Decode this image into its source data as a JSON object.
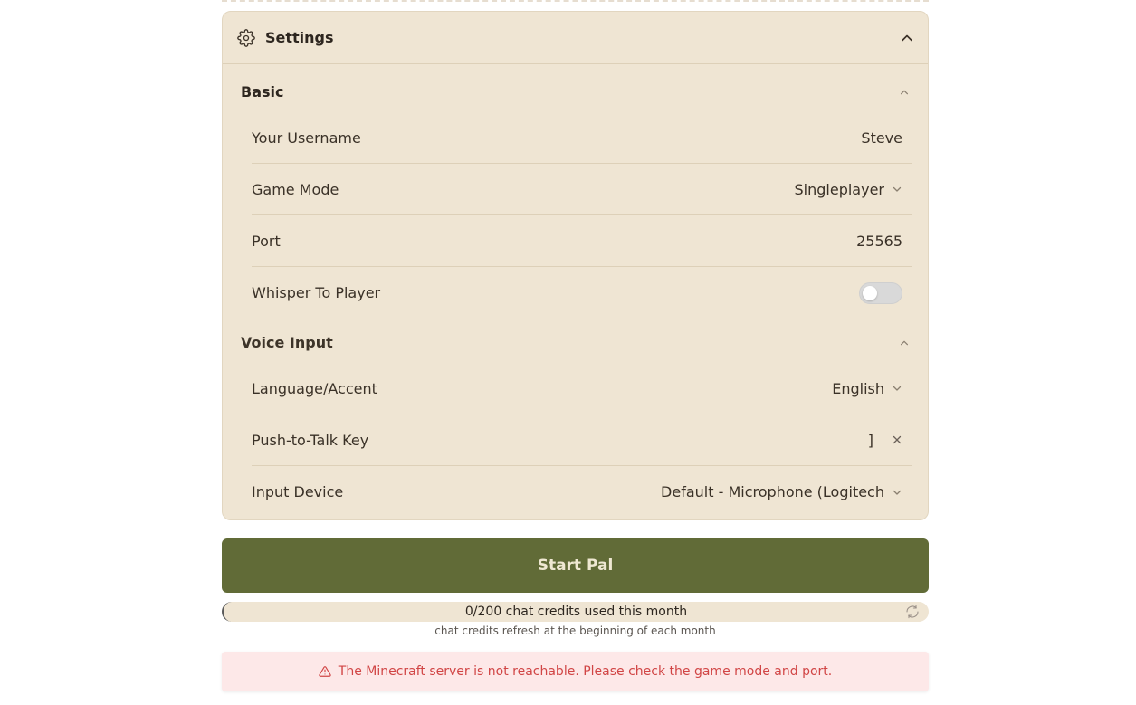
{
  "settings": {
    "title": "Settings",
    "basic": {
      "title": "Basic",
      "username_label": "Your Username",
      "username_value": "Steve",
      "game_mode_label": "Game Mode",
      "game_mode_value": "Singleplayer",
      "port_label": "Port",
      "port_value": "25565",
      "whisper_label": "Whisper To Player",
      "whisper_enabled": false
    },
    "voice": {
      "title": "Voice Input",
      "language_label": "Language/Accent",
      "language_value": "English",
      "ptt_label": "Push-to-Talk Key",
      "ptt_value": "]",
      "device_label": "Input Device",
      "device_value": "Default - Microphone (Logitech"
    }
  },
  "start_button": "Start Pal",
  "credits": {
    "used_text": "0/200 chat credits used this month",
    "used": 0,
    "total": 200,
    "note": "chat credits refresh at the beginning of each month"
  },
  "alert": {
    "message": "The Minecraft server is not reachable. Please check the game mode and port."
  },
  "icons": {
    "settings": "gear-icon",
    "collapse": "chevron-up-icon",
    "dropdown": "chevron-down-icon",
    "clear": "close-icon",
    "refresh": "refresh-icon",
    "warning": "warning-icon"
  },
  "colors": {
    "panel_bg": "#efe5d3",
    "button_bg": "#616b37",
    "button_text": "#efe8d2",
    "alert_bg": "#fde8e8",
    "alert_text": "#d14545"
  }
}
